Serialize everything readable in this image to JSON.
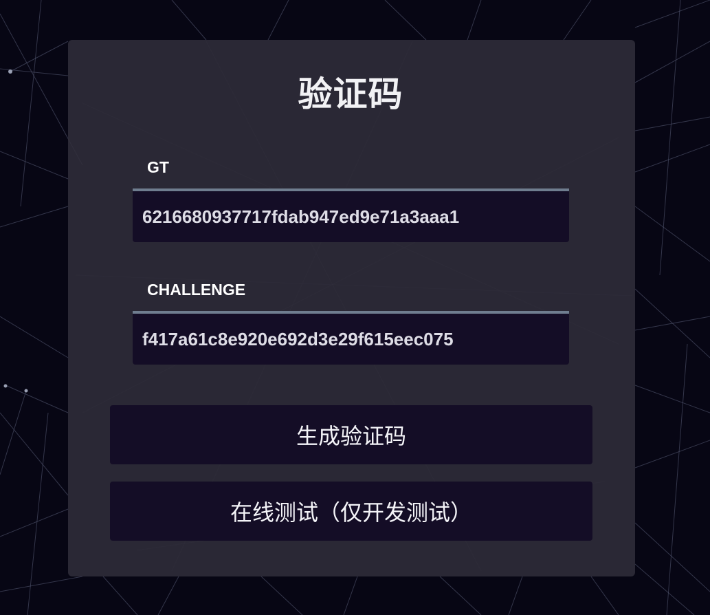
{
  "page": {
    "title": "验证码"
  },
  "form": {
    "gt": {
      "label": "GT",
      "value": "6216680937717fdab947ed9e71a3aaa1"
    },
    "challenge": {
      "label": "CHALLENGE",
      "value": "f417a61c8e920e692d3e29f615eec075"
    }
  },
  "buttons": {
    "generate": "生成验证码",
    "online_test": "在线测试（仅开发测试）"
  },
  "colors": {
    "background": "#070614",
    "card": "#302e3a",
    "input_bg": "#140d26",
    "input_border": "#6f7d8f",
    "button_bg": "#140d26"
  }
}
